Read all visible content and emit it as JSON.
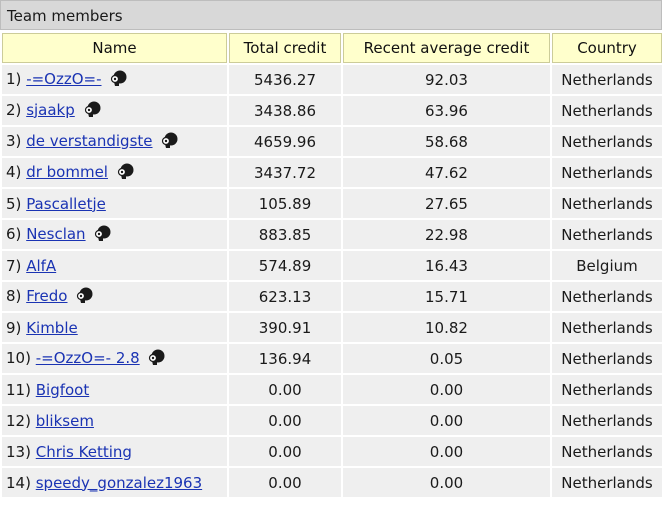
{
  "panel": {
    "title": "Team members"
  },
  "table": {
    "headers": [
      "Name",
      "Total credit",
      "Recent average credit",
      "Country"
    ],
    "rows": [
      {
        "rank": "1)",
        "name": "-=OzzO=-",
        "total": "5436.27",
        "recent": "92.03",
        "country": "Netherlands",
        "has_profile": true
      },
      {
        "rank": "2)",
        "name": "sjaakp",
        "total": "3438.86",
        "recent": "63.96",
        "country": "Netherlands",
        "has_profile": true
      },
      {
        "rank": "3)",
        "name": "de verstandigste",
        "total": "4659.96",
        "recent": "58.68",
        "country": "Netherlands",
        "has_profile": true
      },
      {
        "rank": "4)",
        "name": "dr bommel",
        "total": "3437.72",
        "recent": "47.62",
        "country": "Netherlands",
        "has_profile": true
      },
      {
        "rank": "5)",
        "name": "Pascalletje",
        "total": "105.89",
        "recent": "27.65",
        "country": "Netherlands",
        "has_profile": false
      },
      {
        "rank": "6)",
        "name": "Nesclan",
        "total": "883.85",
        "recent": "22.98",
        "country": "Netherlands",
        "has_profile": true
      },
      {
        "rank": "7)",
        "name": "AlfA",
        "total": "574.89",
        "recent": "16.43",
        "country": "Belgium",
        "has_profile": false
      },
      {
        "rank": "8)",
        "name": "Fredo",
        "total": "623.13",
        "recent": "15.71",
        "country": "Netherlands",
        "has_profile": true
      },
      {
        "rank": "9)",
        "name": "Kimble",
        "total": "390.91",
        "recent": "10.82",
        "country": "Netherlands",
        "has_profile": false
      },
      {
        "rank": "10)",
        "name": "-=OzzO=- 2.8",
        "total": "136.94",
        "recent": "0.05",
        "country": "Netherlands",
        "has_profile": true
      },
      {
        "rank": "11)",
        "name": "Bigfoot",
        "total": "0.00",
        "recent": "0.00",
        "country": "Netherlands",
        "has_profile": false
      },
      {
        "rank": "12)",
        "name": "bliksem",
        "total": "0.00",
        "recent": "0.00",
        "country": "Netherlands",
        "has_profile": false
      },
      {
        "rank": "13)",
        "name": "Chris Ketting",
        "total": "0.00",
        "recent": "0.00",
        "country": "Netherlands",
        "has_profile": false
      },
      {
        "rank": "14)",
        "name": "speedy_gonzalez1963",
        "total": "0.00",
        "recent": "0.00",
        "country": "Netherlands",
        "has_profile": false
      }
    ]
  },
  "icons": {
    "profile": "profile-head-icon"
  },
  "colors": {
    "link": "#1a33b3",
    "header_bg": "#ffffcc",
    "row_bg": "#efefef",
    "title_bg": "#d8d8d8"
  }
}
